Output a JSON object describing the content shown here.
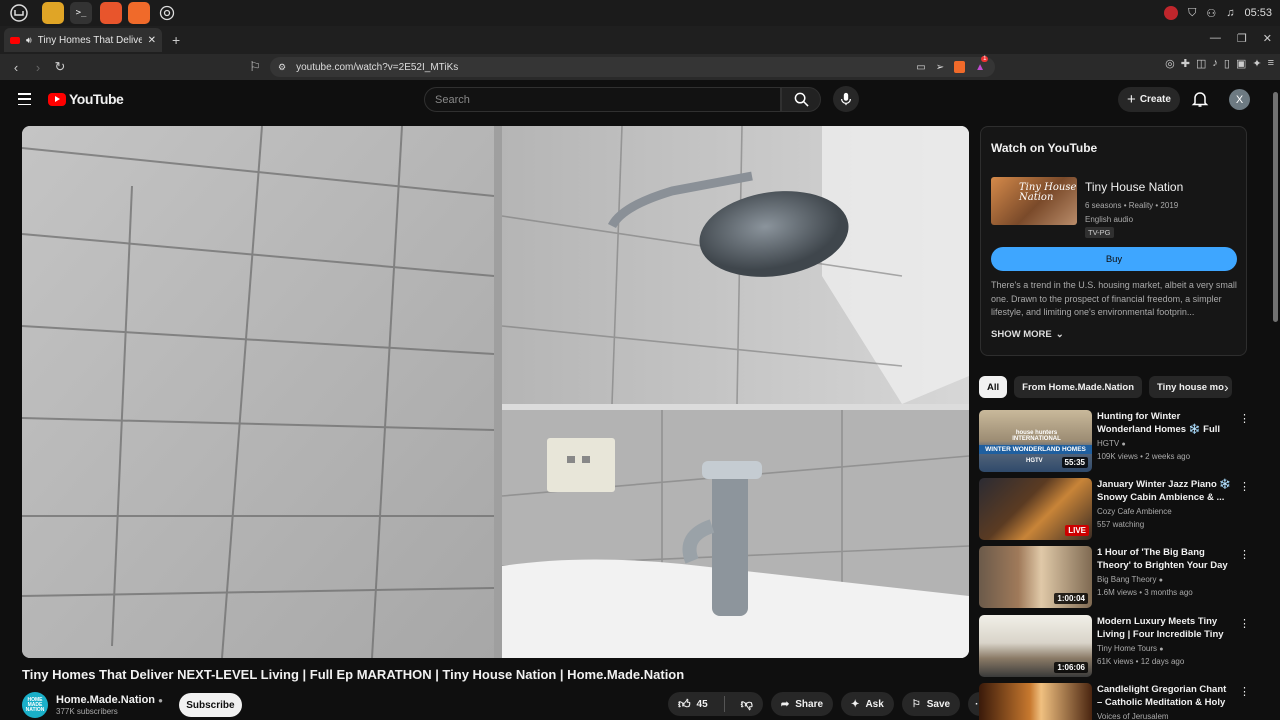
{
  "os": {
    "clock": "05:53"
  },
  "browser": {
    "tab_title": "Tiny Homes That Deliver Ne",
    "new_tab": "+",
    "url": "youtube.com/watch?v=2E52I_MTiKs",
    "ext_badge": "1"
  },
  "youtube": {
    "logo_text": "YouTube",
    "search_placeholder": "Search",
    "create_label": "Create",
    "avatar_letter": "X"
  },
  "video": {
    "title": "Tiny Homes That Deliver NEXT-LEVEL Living | Full Ep MARATHON | Tiny House Nation | Home.Made.Nation",
    "channel_avatar_text": "HOME MADE NATION",
    "channel_name": "Home.Made.Nation",
    "subscribers": "377K subscribers",
    "subscribe_label": "Subscribe",
    "likes": "45",
    "share_label": "Share",
    "ask_label": "Ask",
    "save_label": "Save"
  },
  "watch_panel": {
    "heading": "Watch on YouTube",
    "show_title": "Tiny House Nation",
    "thumb_text": "Tiny House Nation",
    "meta_line1": "6 seasons • Reality • 2019",
    "meta_line2": "English audio",
    "rating": "TV-PG",
    "buy_label": "Buy",
    "description": "There's a trend in the U.S. housing market, albeit a very small one. Drawn to the prospect of financial freedom, a simpler lifestyle, and limiting one's environmental footprin...",
    "show_more": "SHOW MORE"
  },
  "chips": [
    "All",
    "From Home.Made.Nation",
    "Tiny house mo"
  ],
  "recommendations": [
    {
      "title": "Hunting for Winter Wonderland Homes ❄️ Full Episode ...",
      "channel": "HGTV",
      "meta": "109K views • 2 weeks ago",
      "duration": "55:35",
      "thumb_text": "WINTER WONDERLAND HOMES",
      "thumb_label": "HGTV",
      "thumb_top": "house hunters INTERNATIONAL"
    },
    {
      "title": "January Winter Jazz Piano ❄️ Snowy Cabin Ambience & ...",
      "channel": "Cozy Cafe Ambience",
      "meta": "557 watching",
      "live": "LIVE"
    },
    {
      "title": "1 Hour of 'The Big Bang Theory' to Brighten Your Day",
      "channel": "Big Bang Theory",
      "meta": "1.6M views • 3 months ago",
      "duration": "1:00:04"
    },
    {
      "title": "Modern Luxury Meets Tiny Living | Four Incredible Tiny ...",
      "channel": "Tiny Home Tours",
      "meta": "61K views • 12 days ago",
      "duration": "1:06:06"
    },
    {
      "title": "Candlelight Gregorian Chant – Catholic Meditation & Holy ...",
      "channel": "Voices of Jerusalem",
      "meta": ""
    }
  ]
}
